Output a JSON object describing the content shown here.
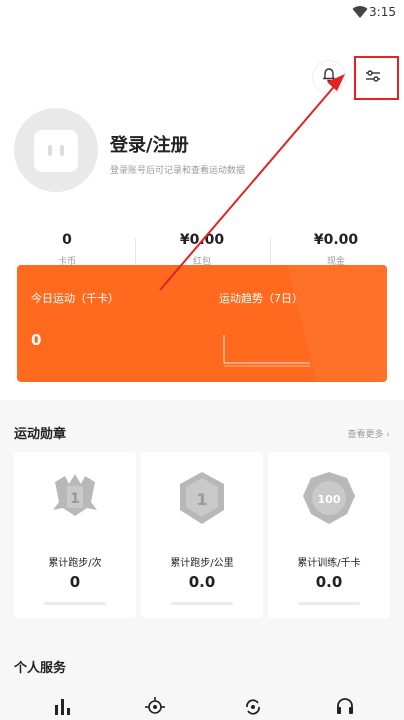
{
  "status_bar": {
    "time": "3:15",
    "wifi_icon": "wifi-icon"
  },
  "header": {
    "bell_icon": "bell-icon",
    "settings_icon": "sliders-icon",
    "login_title": "登录/注册",
    "login_subtitle": "登录账号后可记录和查看运动数据"
  },
  "stats": [
    {
      "value": "0",
      "label": "卡币"
    },
    {
      "value": "¥0.00",
      "label": "红包"
    },
    {
      "value": "¥0.00",
      "label": "现金"
    }
  ],
  "exercise_card": {
    "today_label": "今日运动（千卡）",
    "today_value": "0",
    "trend_label": "运动趋势（7日）",
    "accent_color": "#ff6a1f"
  },
  "medals": {
    "title": "运动勋章",
    "see_more": "查看更多 ›",
    "items": [
      {
        "name": "累计跑步/次",
        "value": "0",
        "icon": "running-count-medal-icon"
      },
      {
        "name": "累计跑步/公里",
        "value": "0.0",
        "icon": "running-distance-medal-icon"
      },
      {
        "name": "累计训练/千卡",
        "value": "0.0",
        "icon": "training-calorie-medal-icon"
      }
    ]
  },
  "personal_services": {
    "title": "个人服务",
    "icons": [
      "stats-icon",
      "target-icon",
      "sync-icon",
      "headset-icon"
    ]
  }
}
